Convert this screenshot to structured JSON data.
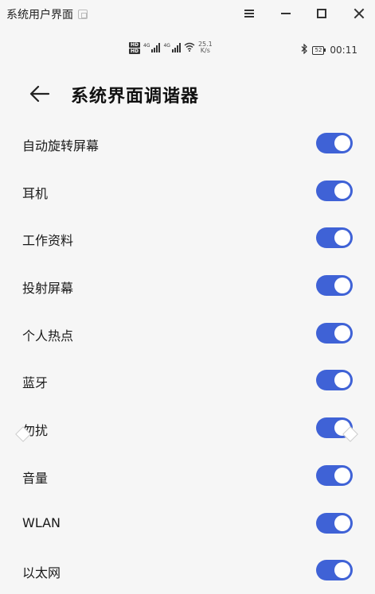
{
  "window": {
    "title": "系统用户界面"
  },
  "status_bar": {
    "hd1": "HD",
    "hd2": "HD",
    "sig1": "4G",
    "sig2": "4G",
    "speed_value": "25.1",
    "speed_unit": "K/s",
    "battery": "52",
    "time": "00:11"
  },
  "header": {
    "title": "系统界面调谐器"
  },
  "settings": [
    {
      "label": "自动旋转屏幕",
      "enabled": true
    },
    {
      "label": "耳机",
      "enabled": true
    },
    {
      "label": "工作资料",
      "enabled": true
    },
    {
      "label": "投射屏幕",
      "enabled": true
    },
    {
      "label": "个人热点",
      "enabled": true
    },
    {
      "label": "蓝牙",
      "enabled": true
    },
    {
      "label": "勿扰",
      "enabled": true
    },
    {
      "label": "音量",
      "enabled": true
    },
    {
      "label": "WLAN",
      "enabled": true
    },
    {
      "label": "以太网",
      "enabled": true
    }
  ],
  "colors": {
    "accent": "#3f62d6",
    "background": "#f6f6f6"
  }
}
